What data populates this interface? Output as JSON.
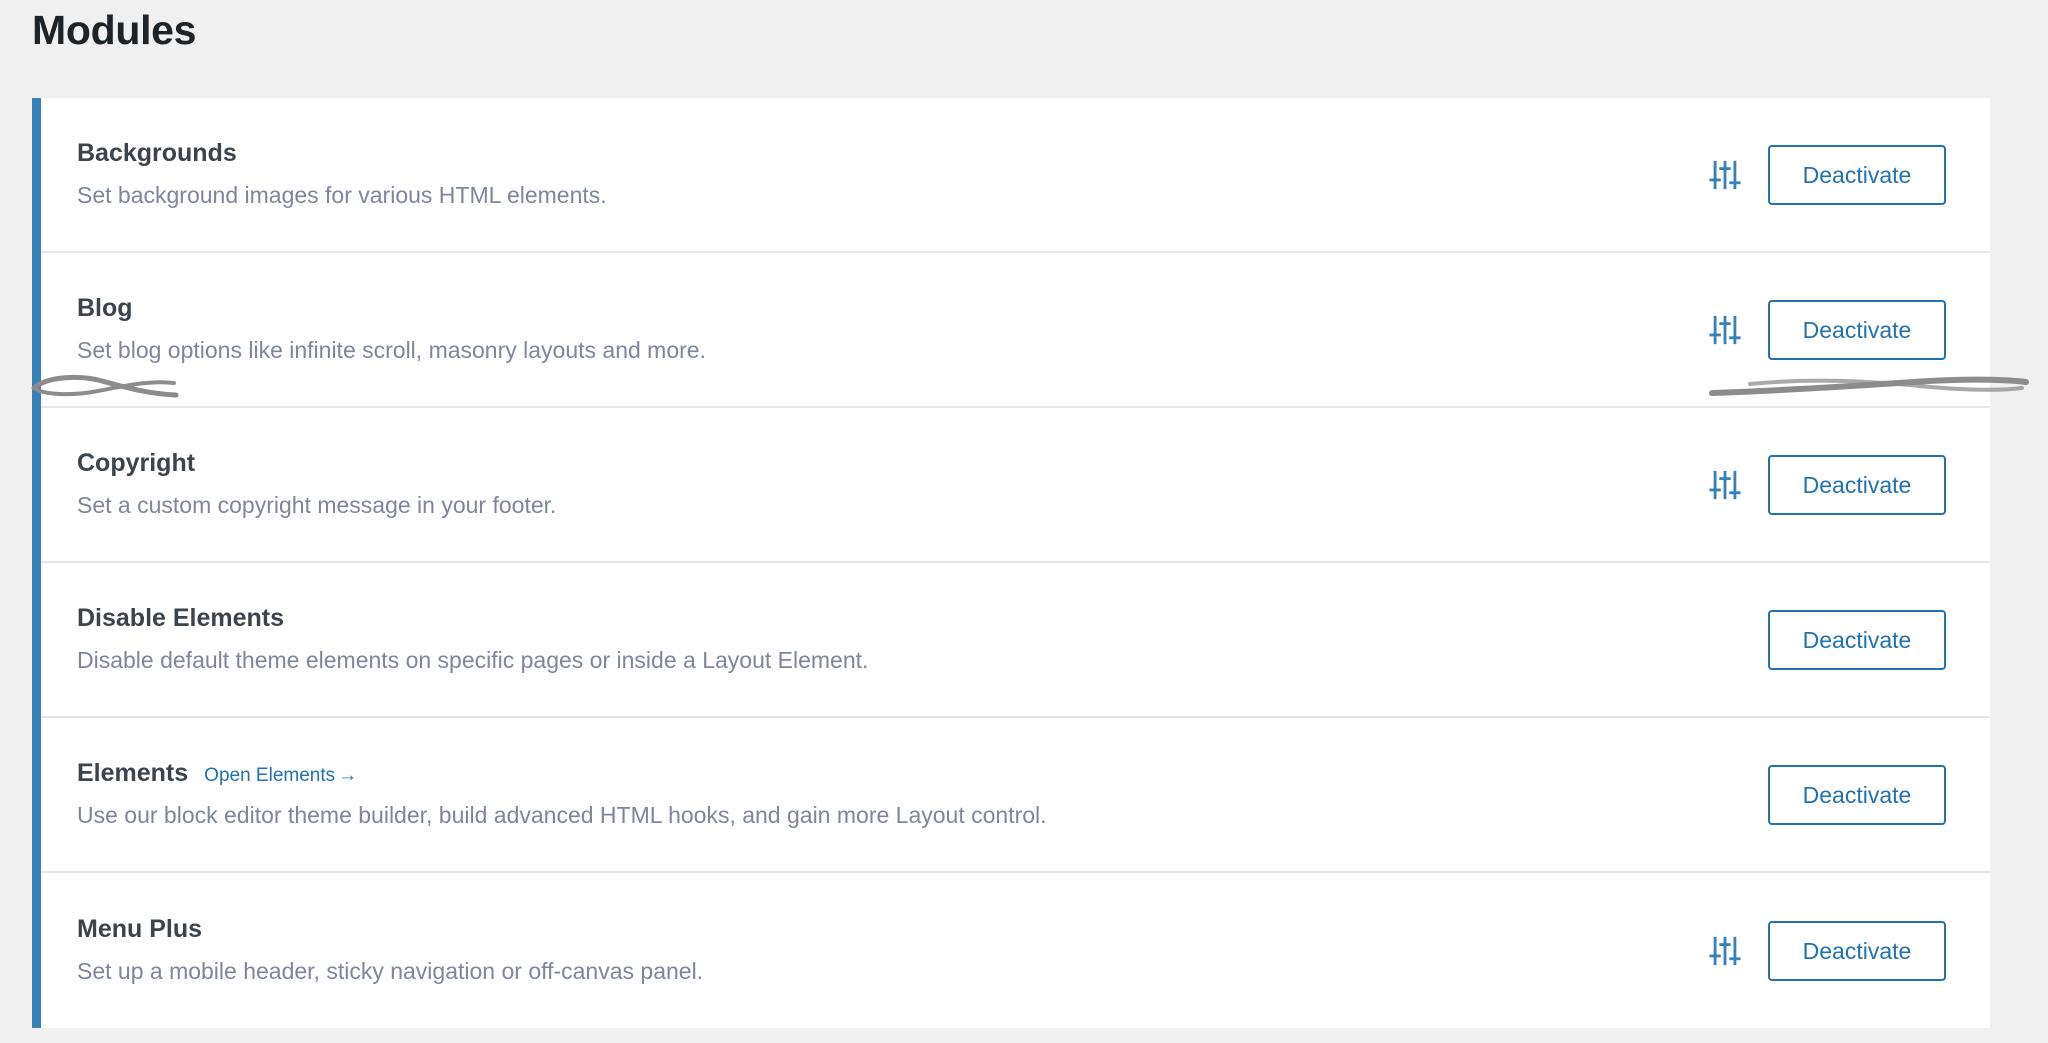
{
  "header": {
    "title": "Modules"
  },
  "colors": {
    "accent_bar": "#3581b8",
    "link": "#2271b1",
    "page_bg": "#f0f0f1",
    "card_bg": "#ffffff",
    "title_text": "#1d2327",
    "module_name_text": "#3c434a",
    "module_desc_text": "#7e8699",
    "annotation": "#8c8c8c"
  },
  "modules": [
    {
      "name": "Backgrounds",
      "description": "Set background images for various HTML elements.",
      "link_label": null,
      "has_settings_icon": true,
      "settings_icon": "sliders-icon",
      "button_label": "Deactivate"
    },
    {
      "name": "Blog",
      "description": "Set blog options like infinite scroll, masonry layouts and more.",
      "link_label": null,
      "has_settings_icon": true,
      "settings_icon": "sliders-icon",
      "button_label": "Deactivate"
    },
    {
      "name": "Copyright",
      "description": "Set a custom copyright message in your footer.",
      "link_label": null,
      "has_settings_icon": true,
      "settings_icon": "sliders-icon",
      "button_label": "Deactivate"
    },
    {
      "name": "Disable Elements",
      "description": "Disable default theme elements on specific pages or inside a Layout Element.",
      "link_label": null,
      "has_settings_icon": false,
      "settings_icon": null,
      "button_label": "Deactivate"
    },
    {
      "name": "Elements",
      "description": "Use our block editor theme builder, build advanced HTML hooks, and gain more Layout control.",
      "link_label": "Open Elements",
      "link_arrow": "→",
      "has_settings_icon": false,
      "settings_icon": null,
      "button_label": "Deactivate"
    },
    {
      "name": "Menu Plus",
      "description": "Set up a mobile header, sticky navigation or off-canvas panel.",
      "link_label": null,
      "has_settings_icon": true,
      "settings_icon": "sliders-icon",
      "button_label": "Deactivate"
    }
  ],
  "annotations": [
    {
      "name": "handdrawn-mark-left",
      "shape": "squiggle-underline"
    },
    {
      "name": "handdrawn-mark-right",
      "shape": "squiggle-underline"
    }
  ]
}
